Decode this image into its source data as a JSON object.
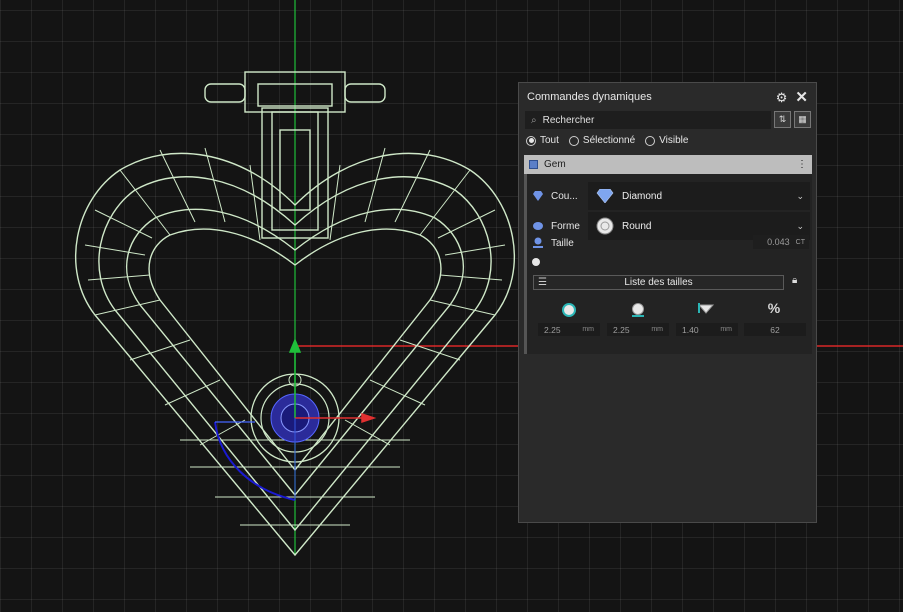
{
  "panel": {
    "title": "Commandes dynamiques",
    "search_placeholder": "Rechercher",
    "filters": [
      {
        "label": "Tout",
        "selected": true
      },
      {
        "label": "Sélectionné",
        "selected": false
      },
      {
        "label": "Visible",
        "selected": false
      }
    ],
    "group": {
      "label": "Gem"
    },
    "color_row": {
      "label": "Cou...",
      "value": "Diamond"
    },
    "shape_row": {
      "label": "Forme",
      "value": "Round"
    },
    "size_row": {
      "label": "Taille",
      "value": "0.043",
      "unit": "CT"
    },
    "sizes_list_label": "Liste des tailles",
    "dimensions": [
      {
        "icon": "gem-width-icon",
        "value": "2.25",
        "unit": "mm"
      },
      {
        "icon": "gem-length-icon",
        "value": "2.25",
        "unit": "mm"
      },
      {
        "icon": "gem-height-icon",
        "value": "1.40",
        "unit": "mm"
      },
      {
        "icon": "percent-icon",
        "symbol": "%",
        "value": "62",
        "unit": ""
      }
    ],
    "accent_color": "#5b7fc8"
  },
  "viewport": {
    "background": "#141414",
    "wire_color": "#cfe8c8",
    "axis_x_color": "#ff2a2a",
    "axis_y_color": "#1fbf3a"
  }
}
